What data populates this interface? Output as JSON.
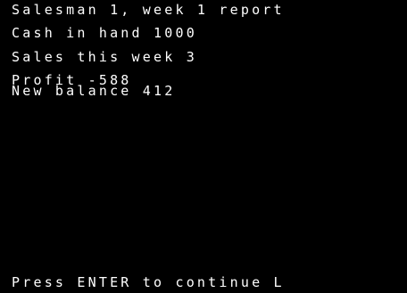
{
  "report": {
    "title": "Salesman 1, week 1 report",
    "cash_in_hand": "Cash in hand 1000",
    "sales_this_week": "Sales this week 3",
    "profit": "Profit -588",
    "new_balance": "New balance 412"
  },
  "prompt": {
    "continue_text": "Press ENTER to continue L"
  },
  "colors": {
    "background": "#000000",
    "text": "#ffffff"
  }
}
